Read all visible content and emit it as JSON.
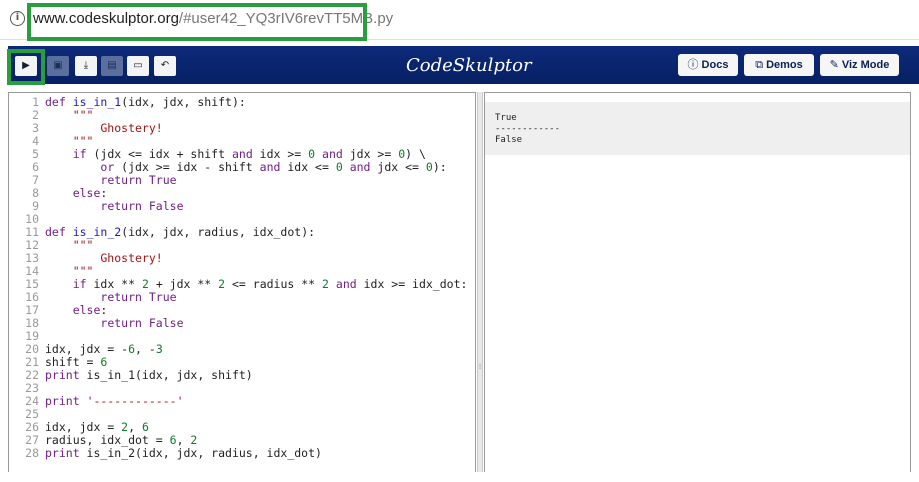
{
  "browser": {
    "url_domain": "www.codeskulptor.org",
    "url_path": "/#user42_YQ3rIV6revTT5MB.py",
    "info_icon_glyph": "i"
  },
  "toolbar": {
    "run_glyph": "▶",
    "save_glyph": "▣",
    "download_glyph": "⤓",
    "reset_glyph": "▤",
    "open_glyph": "▭",
    "undo_glyph": "↶"
  },
  "header": {
    "logo": "CodeSkulptor",
    "docs_icon": "ⓘ",
    "docs_label": "Docs",
    "demos_icon": "⧉",
    "demos_label": "Demos",
    "viz_icon": "✎",
    "viz_label": "Viz Mode"
  },
  "colors": {
    "header_bg": "#0d2a7a",
    "highlight": "#2a9d3f",
    "keyword": "#6f1f86",
    "string": "#a01515",
    "number": "#117a2b"
  },
  "splitter_glyph": "⁞",
  "code": [
    "def is_in_1(idx, jdx, shift):",
    "    \"\"\"",
    "        Ghostery!",
    "    \"\"\"",
    "    if (jdx <= idx + shift and idx >= 0 and jdx >= 0) \\",
    "        or (jdx >= idx - shift and idx <= 0 and jdx <= 0):",
    "        return True",
    "    else:",
    "        return False",
    "",
    "def is_in_2(idx, jdx, radius, idx_dot):",
    "    \"\"\"",
    "        Ghostery!",
    "    \"\"\"",
    "    if idx ** 2 + jdx ** 2 <= radius ** 2 and idx >= idx_dot:",
    "        return True",
    "    else:",
    "        return False",
    "",
    "idx, jdx = -6, -3",
    "shift = 6",
    "print is_in_1(idx, jdx, shift)",
    "",
    "print '------------'",
    "",
    "idx, jdx = 2, 6",
    "radius, idx_dot = 6, 2",
    "print is_in_2(idx, jdx, radius, idx_dot)"
  ],
  "output": "True\n------------\nFalse"
}
